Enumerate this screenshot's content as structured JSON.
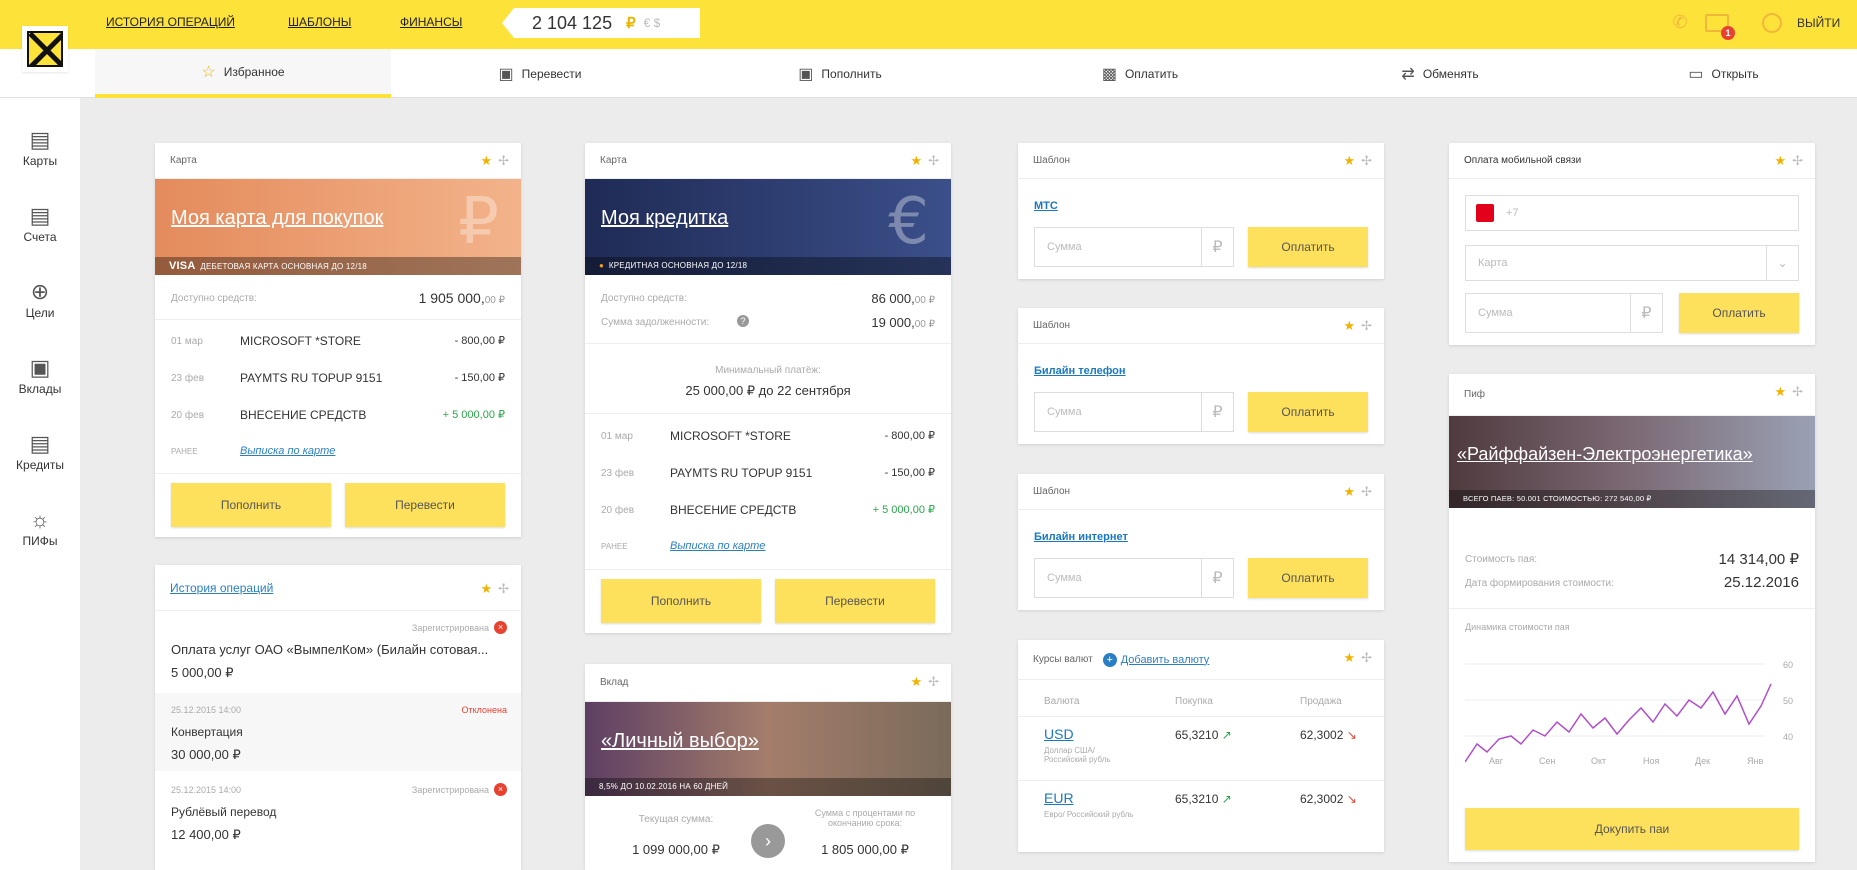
{
  "topbar": {
    "links": [
      "ИСТОРИЯ ОПЕРАЦИЙ",
      "ШАБЛОНЫ",
      "ФИНАНСЫ"
    ],
    "balance": "2 104 125",
    "currency_active": "₽",
    "currency_others": "€ $",
    "notifications": "1",
    "logout": "ВЫЙТИ"
  },
  "tabs": [
    {
      "label": "Избранное",
      "icon": "star-icon"
    },
    {
      "label": "Перевести",
      "icon": "transfer-icon"
    },
    {
      "label": "Пополнить",
      "icon": "topup-icon"
    },
    {
      "label": "Оплатить",
      "icon": "pay-icon"
    },
    {
      "label": "Обменять",
      "icon": "exchange-icon"
    },
    {
      "label": "Открыть",
      "icon": "open-icon"
    }
  ],
  "sidebar": [
    {
      "label": "Карты",
      "icon": "card-icon"
    },
    {
      "label": "Счета",
      "icon": "account-icon"
    },
    {
      "label": "Цели",
      "icon": "target-icon"
    },
    {
      "label": "Вклады",
      "icon": "safe-icon"
    },
    {
      "label": "Кредиты",
      "icon": "credit-icon"
    },
    {
      "label": "ПИФы",
      "icon": "fund-icon"
    }
  ],
  "card1": {
    "header": "Карта",
    "title": "Моя карта для покупок",
    "brand": "VISA",
    "sub": "ДЕБЕТОВАЯ КАРТА   ОСНОВНАЯ   ДО 12/18",
    "available_label": "Доступно средств:",
    "available_int": "1 905 000,",
    "available_dec": "00 ₽",
    "ops": [
      {
        "date": "01 мар",
        "name": "MICROSOFT *STORE",
        "amount": "- 800,00 ₽",
        "green": false
      },
      {
        "date": "23 фев",
        "name": "PAYMTS RU TOPUP 9151",
        "amount": "- 150,00 ₽",
        "green": false
      },
      {
        "date": "20 фев",
        "name": "ВНЕСЕНИЕ СРЕДСТВ",
        "amount": "+ 5 000,00 ₽",
        "green": true
      }
    ],
    "earlier": "РАНЕЕ",
    "statement": "Выписка по карте",
    "btn_topup": "Пополнить",
    "btn_transfer": "Перевести"
  },
  "card2": {
    "header": "Карта",
    "title": "Моя кредитка",
    "sub": "КРЕДИТНАЯ   ОСНОВНАЯ   ДО 12/18",
    "available_label": "Доступно средств:",
    "available_int": "86 000,",
    "available_dec": "00 ₽",
    "debt_label": "Сумма задолженности:",
    "debt_int": "19 000,",
    "debt_dec": "00 ₽",
    "min_label": "Минимальный платёж:",
    "min_value": "25 000,00 ₽ до 22 сентября",
    "ops": [
      {
        "date": "01 мар",
        "name": "MICROSOFT *STORE",
        "amount": "- 800,00 ₽",
        "green": false
      },
      {
        "date": "23 фев",
        "name": "PAYMTS RU TOPUP 9151",
        "amount": "- 150,00 ₽",
        "green": false
      },
      {
        "date": "20 фев",
        "name": "ВНЕСЕНИЕ СРЕДСТВ",
        "amount": "+ 5 000,00 ₽",
        "green": true
      }
    ],
    "earlier": "РАНЕЕ",
    "statement": "Выписка по карте",
    "btn_topup": "Пополнить",
    "btn_transfer": "Перевести"
  },
  "history": {
    "header": "История операций",
    "items": [
      {
        "status": "Зарегистрирована",
        "text": "Оплата услуг ОАО «ВымпелКом» (Билайн сотовая...",
        "amount": "5 000,00 ₽",
        "date": ""
      },
      {
        "status": "Отклонена",
        "text": "Конвертация",
        "amount": "30 000,00 ₽",
        "date": "25.12.2015  14:00"
      },
      {
        "status": "Зарегистрирована",
        "text": "Рублёвый перевод",
        "amount": "12 400,00 ₽",
        "date": "25.12.2015  14:00"
      }
    ]
  },
  "deposit": {
    "header": "Вклад",
    "title": "«Личный выбор»",
    "sub": "8,5%   ДО 10.02.2016   НА 60 ДНЕЙ",
    "current_label": "Текущая сумма:",
    "current_value": "1 099 000,00 ₽",
    "final_label": "Сумма с процентами по окончанию срока:",
    "final_value": "1 805 000,00 ₽"
  },
  "templates": [
    {
      "header": "Шаблон",
      "name": "МТС",
      "placeholder": "Сумма",
      "btn": "Оплатить"
    },
    {
      "header": "Шаблон",
      "name": "Билайн телефон",
      "placeholder": "Сумма",
      "btn": "Оплатить"
    },
    {
      "header": "Шаблон",
      "name": "Билайн интернет",
      "placeholder": "Сумма",
      "btn": "Оплатить"
    }
  ],
  "rates": {
    "header": "Курсы валют",
    "add": "Добавить валюту",
    "cols": [
      "Валюта",
      "Покупка",
      "Продажа"
    ],
    "rows": [
      {
        "code": "USD",
        "desc": "Доллар США/ Российский рубль",
        "buy": "65,3210",
        "sell": "62,3002"
      },
      {
        "code": "EUR",
        "desc": "Евро/ Российский рубль",
        "buy": "65,3210",
        "sell": "62,3002"
      }
    ]
  },
  "mobile": {
    "header": "Оплата мобильной связи",
    "phone_placeholder": "+7",
    "card_placeholder": "Карта",
    "sum_placeholder": "Сумма",
    "btn": "Оплатить"
  },
  "pif": {
    "header": "Пиф",
    "title": "«Райффайзен-Электроэнергетика»",
    "sub": "ВСЕГО ПАЕВ: 50.001   СТОИМОСТЬЮ: 272 540,00 ₽",
    "price_label": "Стоимость пая:",
    "price_value": "14 314,00 ₽",
    "date_label": "Дата формирования стоимости:",
    "date_value": "25.12.2016",
    "chart_label": "Динамика стоимости пая",
    "months": [
      "Авг",
      "Сен",
      "Окт",
      "Ноя",
      "Дек",
      "Янв"
    ],
    "yticks": [
      "60",
      "50",
      "40"
    ],
    "btn": "Докупить паи"
  },
  "colors": {
    "accent": "#fde23a",
    "button": "#fde05c",
    "link": "#2a7fc4"
  }
}
